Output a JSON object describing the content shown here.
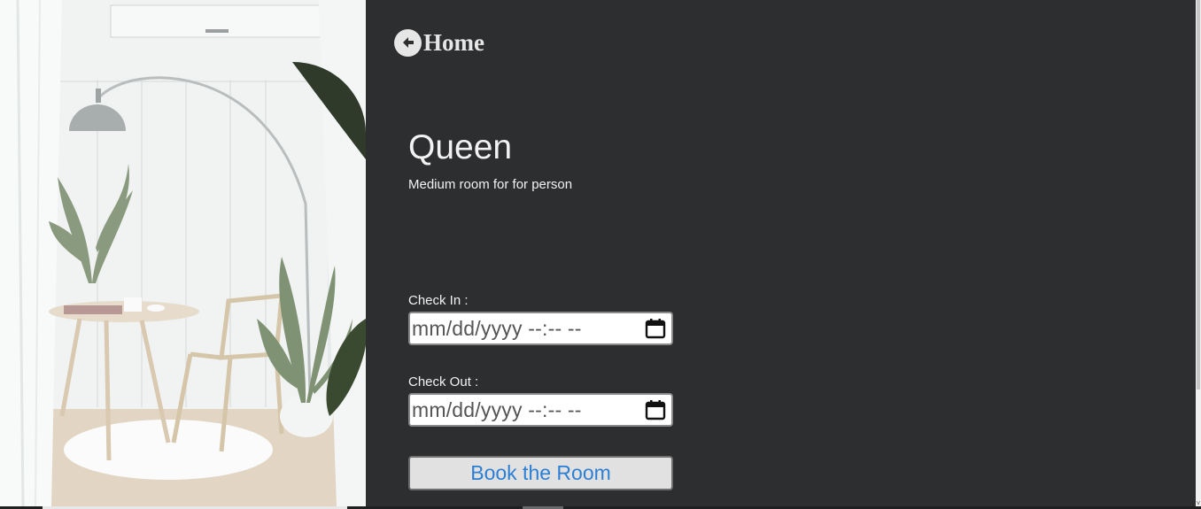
{
  "photo": {
    "alt": "room interior with arc floor lamp, round table, chair and plants"
  },
  "nav": {
    "home_label": "Home",
    "home_icon": "arrow-left-circle-icon"
  },
  "room": {
    "title": "Queen",
    "description": "Medium room for for person"
  },
  "form": {
    "check_in": {
      "label": "Check In :",
      "placeholder": "mm/dd/yyyy --:-- --",
      "icon": "calendar-icon"
    },
    "check_out": {
      "label": "Check Out :",
      "placeholder": "mm/dd/yyyy --:-- --",
      "icon": "calendar-icon"
    },
    "submit_label": "Book the Room"
  },
  "colors": {
    "panel_bg": "#2d2e30",
    "text": "#f2f2f2",
    "button_text": "#2b7fd4",
    "button_bg": "#e1e1e1"
  }
}
